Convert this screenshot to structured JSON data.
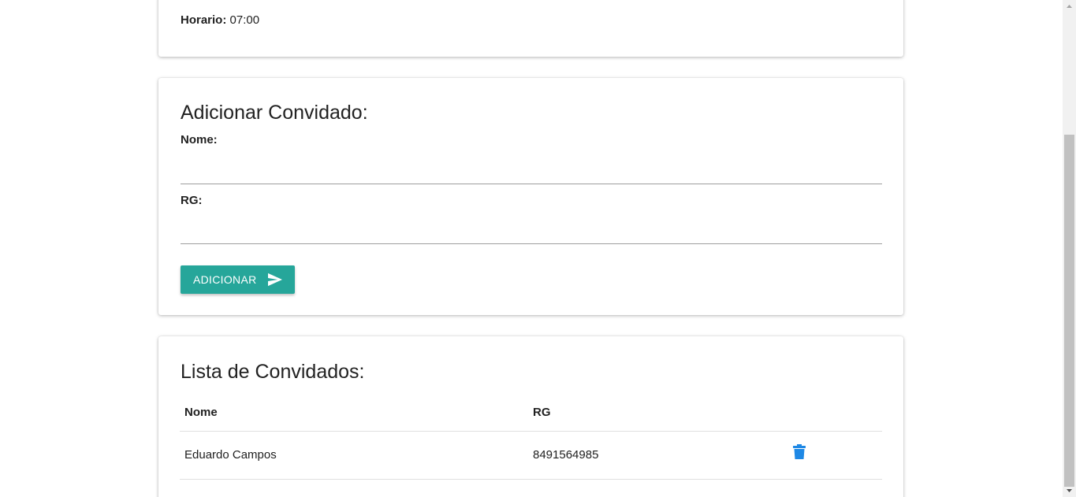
{
  "event_card": {
    "horario_label": "Horario:",
    "horario_value": " 07:00"
  },
  "add_guest": {
    "title": "Adicionar Convidado:",
    "nome_label": "Nome:",
    "nome_value": "",
    "rg_label": "RG:",
    "rg_value": "",
    "button_label": "ADICIONAR",
    "button_icon": "send-icon",
    "button_color": "#26a69a"
  },
  "guest_list": {
    "title": "Lista de Convidados:",
    "columns": [
      "Nome",
      "RG",
      ""
    ],
    "rows": [
      {
        "nome": "Eduardo Campos",
        "rg": "8491564985",
        "action_icon": "trash-icon"
      }
    ],
    "action_color": "#1e88e5"
  }
}
